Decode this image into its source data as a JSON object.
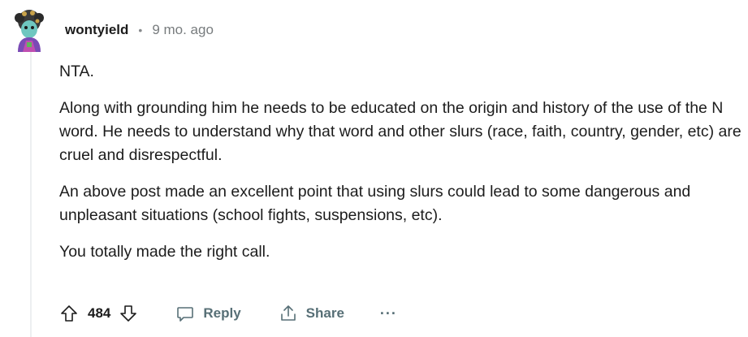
{
  "comment": {
    "author": "wontyield",
    "separator": "•",
    "timestamp": "9 mo. ago",
    "paragraphs": [
      "NTA.",
      "Along with grounding him he needs to be educated on the origin and history of the use of the N word. He needs to understand why that word and other slurs (race, faith, country, gender, etc) are cruel and disrespectful.",
      "An above post made an excellent point that using slurs could lead to some dangerous and unpleasant situations (school fights, suspensions, etc).",
      "You totally made the right call."
    ]
  },
  "actions": {
    "score": "484",
    "reply_label": "Reply",
    "share_label": "Share",
    "more_label": "···"
  },
  "icons": {
    "avatar": "avatar-icon",
    "upvote": "upvote-arrow-icon",
    "downvote": "downvote-arrow-icon",
    "reply": "speech-bubble-icon",
    "share": "share-icon",
    "more": "ellipsis-icon"
  }
}
